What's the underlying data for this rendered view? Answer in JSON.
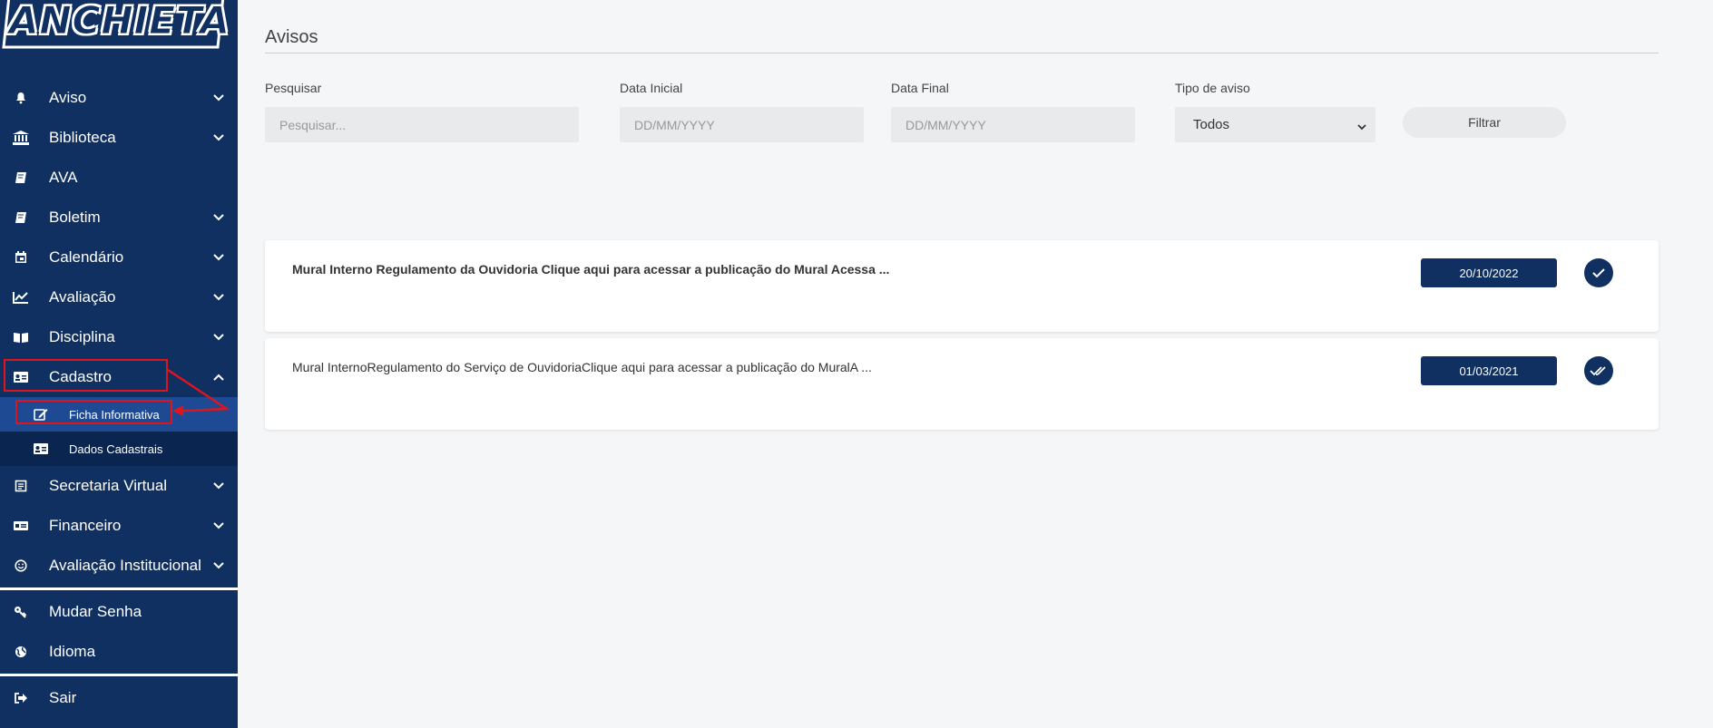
{
  "app": {
    "logo_text": "ANCHIETA"
  },
  "sidebar": {
    "items": [
      {
        "label": "Aviso",
        "icon": "bell-icon"
      },
      {
        "label": "Biblioteca",
        "icon": "bank-icon"
      },
      {
        "label": "AVA",
        "icon": "book-icon"
      },
      {
        "label": "Boletim",
        "icon": "book-icon"
      },
      {
        "label": "Calendário",
        "icon": "calendar-icon"
      },
      {
        "label": "Avaliação",
        "icon": "chart-icon"
      },
      {
        "label": "Disciplina",
        "icon": "open-book-icon"
      },
      {
        "label": "Cadastro",
        "icon": "id-card-icon"
      },
      {
        "label": "Secretaria Virtual",
        "icon": "document-icon"
      },
      {
        "label": "Financeiro",
        "icon": "money-icon"
      },
      {
        "label": "Avaliação Institucional",
        "icon": "smile-icon"
      },
      {
        "label": "Mudar Senha",
        "icon": "key-icon"
      },
      {
        "label": "Idioma",
        "icon": "globe-icon"
      },
      {
        "label": "Sair",
        "icon": "sign-out-icon"
      }
    ],
    "cadastro_sub": [
      {
        "label": "Ficha Informativa",
        "icon": "edit-icon"
      },
      {
        "label": "Dados Cadastrais",
        "icon": "id-card-icon"
      }
    ]
  },
  "main": {
    "title": "Avisos",
    "filters": {
      "search_label": "Pesquisar",
      "search_placeholder": "Pesquisar...",
      "start_label": "Data Inicial",
      "start_placeholder": "DD/MM/YYYY",
      "end_label": "Data Final",
      "end_placeholder": "DD/MM/YYYY",
      "type_label": "Tipo de aviso",
      "type_value": "Todos",
      "filter_button": "Filtrar"
    },
    "notices": [
      {
        "text": "Mural Interno Regulamento da Ouvidoria Clique aqui para acessar a publicação do Mural Acessa ...",
        "date": "20/10/2022",
        "status": "unread"
      },
      {
        "text": "Mural InternoRegulamento do Serviço de OuvidoriaClique aqui para acessar a publicação do MuralA ...",
        "date": "01/03/2021",
        "status": "read"
      }
    ]
  },
  "colors": {
    "sidebar_bg": "#0f3061",
    "accent_red": "#e0141c",
    "active_sub": "#1d4a93"
  }
}
